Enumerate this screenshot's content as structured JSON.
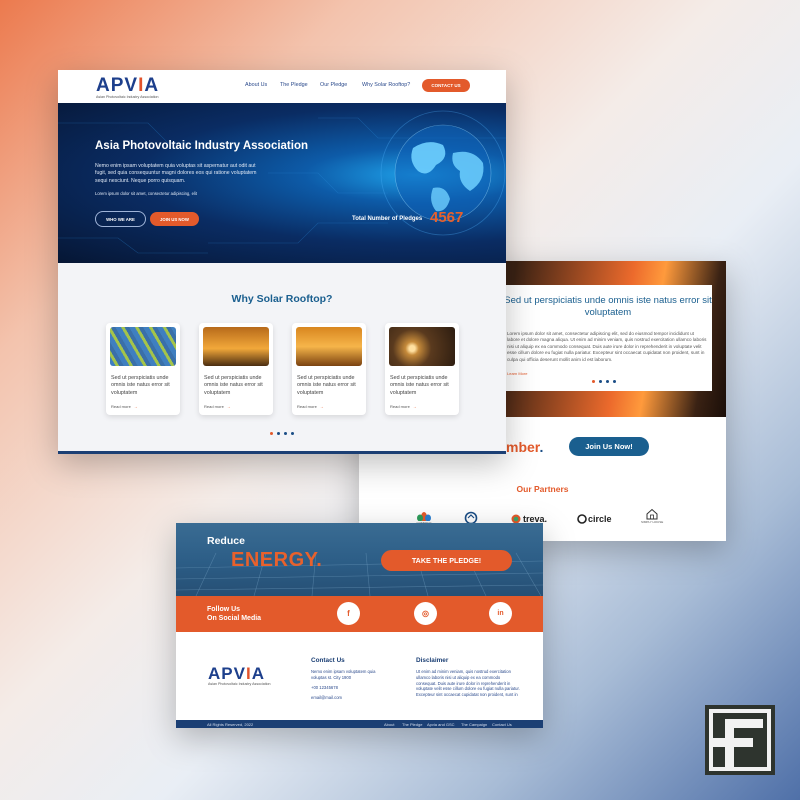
{
  "brand": {
    "name_part1": "APV",
    "name_part2": "I",
    "name_part3": "A",
    "tagline": "Asian Photovoltaic Industry Association",
    "primary_color": "#1d3f8c",
    "accent_color": "#e35a2b"
  },
  "nav": {
    "items": [
      "About Us",
      "The Pledge",
      "Our Pledge",
      "Why Solar Rooftop?"
    ],
    "contact_label": "CONTACT US"
  },
  "hero": {
    "title": "Asia Photovoltaic Industry Association",
    "text": "Nemo enim ipsam voluptatem quia voluptas sit aspernatur aut odit aut fugit, sed quia consequuntur magni dolores eos qui ratione voluptatem sequi nesciunt. Neque porro quisquam.",
    "small_text": "Lorem ipsum dolor sit amet, consectetur adipiscing, elit",
    "btn_who": "WHO WE ARE",
    "btn_join": "JOIN US NOW",
    "pledges_label": "Total Number of Pledges",
    "pledges_count": "4567"
  },
  "why": {
    "title": "Why Solar Rooftop?",
    "cards": [
      {
        "text": "Sed ut perspiciatis unde omnis iste natus error sit voluptatem",
        "read_more": "Read more"
      },
      {
        "text": "Sed ut perspiciatis unde omnis iste natus error sit voluptatem",
        "read_more": "Read more"
      },
      {
        "text": "Sed ut perspiciatis unde omnis iste natus error sit voluptatem",
        "read_more": "Read more"
      },
      {
        "text": "Sed ut perspiciatis unde omnis iste natus error sit voluptatem",
        "read_more": "Read more"
      }
    ],
    "arrow": "→"
  },
  "about": {
    "heading": "Sed ut perspiciatis unde omnis iste natus error sit voluptatem",
    "body": "Lorem ipsum dolor sit amet, consectetur adipiscing elit, sed do eiusmod tempor incididunt ut labore et dolore magna aliqua. Ut enim ad minim veniam, quis nostrud exercitation ullamco laboris nisi ut aliquip ex ea commodo consequat. Duis aute irure dolor in reprehenderit in voluptate velit esse cillum dolore eu fugiat nulla pariatur. Excepteur sint occaecat cupidatat non proident, sunt in culpa qui officia deserunt mollit anim id est laborum.",
    "learn_more": "Learn More"
  },
  "member": {
    "partial_text": "mber",
    "period": ".",
    "join_button": "Join Us Now!"
  },
  "partners": {
    "title": "Our Partners",
    "items": [
      {
        "name": "COMPANY",
        "icon": "lotus-icon"
      },
      {
        "name": "COMPANY",
        "icon": "cycle-icon"
      },
      {
        "name": "treva.",
        "icon": "treva-icon"
      },
      {
        "name": "circle",
        "icon": "circle-icon"
      },
      {
        "name": "SIMPLY HOUSE",
        "icon": "house-icon"
      }
    ]
  },
  "cta": {
    "reduce": "Reduce",
    "energy": "ENERGY.",
    "pledge_button": "TAKE THE PLEDGE!"
  },
  "social": {
    "follow_line1": "Follow Us",
    "follow_line2": "On Social Media",
    "facebook": "f",
    "instagram": "◎",
    "linkedin": "in"
  },
  "footer": {
    "contact_title": "Contact Us",
    "contact_address": "Nemo enim ipsam voluptatem quia voluptas st. City 1900",
    "contact_phone": "+00 12345678",
    "contact_email": "email@mail.com",
    "disclaimer_title": "Disclaimer",
    "disclaimer_text": "Ut enim ad minim veniam, quis nostrud exercitation ullamco laboris nisi ut aliquip ex ea commodo consequat. Duis aute irure dolor in reprehenderit in voluptate velit esse cillum dolore eu fugiat nulla pariatur. Excepteur sint occaecat cupidatat non proident, sunt in",
    "copyright": "All Rights Reserved, 2022",
    "links": [
      "About",
      "The Pledge",
      "Apvia and GSC",
      "The Campaign",
      "Contact Us"
    ]
  }
}
